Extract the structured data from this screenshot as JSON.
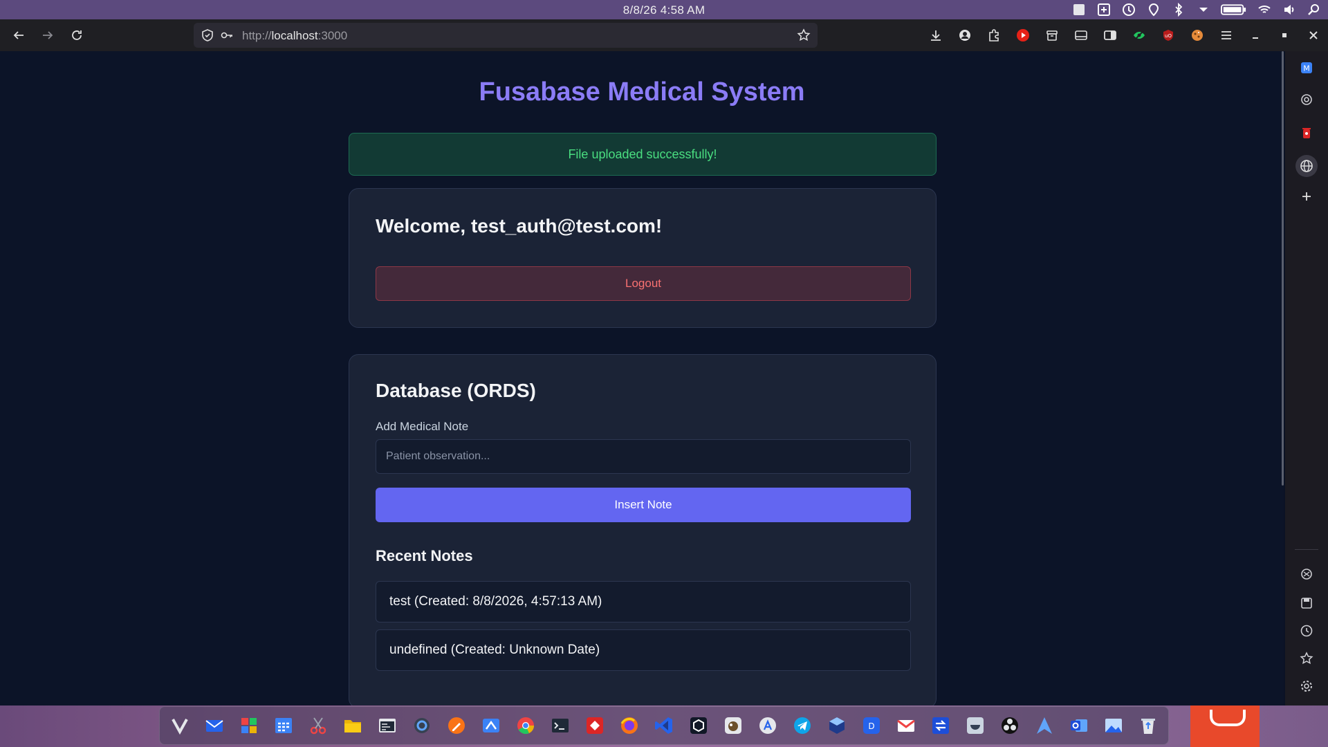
{
  "system_bar": {
    "clock": "8/8/26  4:58 AM",
    "tray_icons": [
      "app-square-icon",
      "screen-share-icon",
      "update-icon",
      "location-icon",
      "bluetooth-icon",
      "dropdown-icon",
      "battery-icon",
      "wifi-icon",
      "volume-icon",
      "search-icon"
    ]
  },
  "browser": {
    "url_prefix": "http://",
    "url_host": "localhost",
    "url_suffix": ":3000",
    "toolbar_icons": [
      "download-icon",
      "account-icon",
      "extensions-icon",
      "youtube-icon",
      "archive-icon",
      "sidebar-icon",
      "reader-icon",
      "eye-icon",
      "ublock-icon",
      "cookie-icon",
      "menu-icon",
      "minimize-icon",
      "maximize-icon",
      "close-icon"
    ],
    "sidebar_icons": [
      "m-app-icon",
      "chatgpt-icon",
      "trash-app-icon",
      "globe-icon",
      "plus-icon",
      "openai-icon",
      "save-icon",
      "history-icon",
      "bookmark-icon",
      "settings-icon"
    ]
  },
  "page": {
    "title": "Fusabase Medical System",
    "alert": "File uploaded successfully!",
    "welcome": "Welcome, test_auth@test.com!",
    "logout_label": "Logout",
    "db_heading": "Database (ORDS)",
    "note_label": "Add Medical Note",
    "note_placeholder": "Patient observation...",
    "insert_label": "Insert Note",
    "recent_heading": "Recent Notes",
    "notes": [
      "test (Created: 8/8/2026, 4:57:13 AM)",
      "undefined (Created: Unknown Date)"
    ]
  },
  "dock": {
    "icons": [
      "vivaldi-icon",
      "mail-icon",
      "office-icon",
      "calendar-icon",
      "scissors-icon",
      "files-icon",
      "task-manager-icon",
      "settings-gear-icon",
      "pen-icon",
      "remote-desktop-icon",
      "chrome-icon",
      "terminal-icon",
      "anydesk-icon",
      "firefox-icon",
      "vscode-icon",
      "box-icon",
      "gimp-icon",
      "app-store-icon",
      "telegram-icon",
      "virtualbox-icon",
      "dbeaver-icon",
      "gmail-icon",
      "transfer-icon",
      "monitor-icon",
      "obs-icon",
      "arch-icon",
      "outlook-icon",
      "photos-icon",
      "recycle-bin-icon"
    ]
  },
  "colors": {
    "accent": "#6366f1",
    "title": "#8b7cf6",
    "success": "#4ade80",
    "danger": "#f87171",
    "background": "#0c1428"
  }
}
